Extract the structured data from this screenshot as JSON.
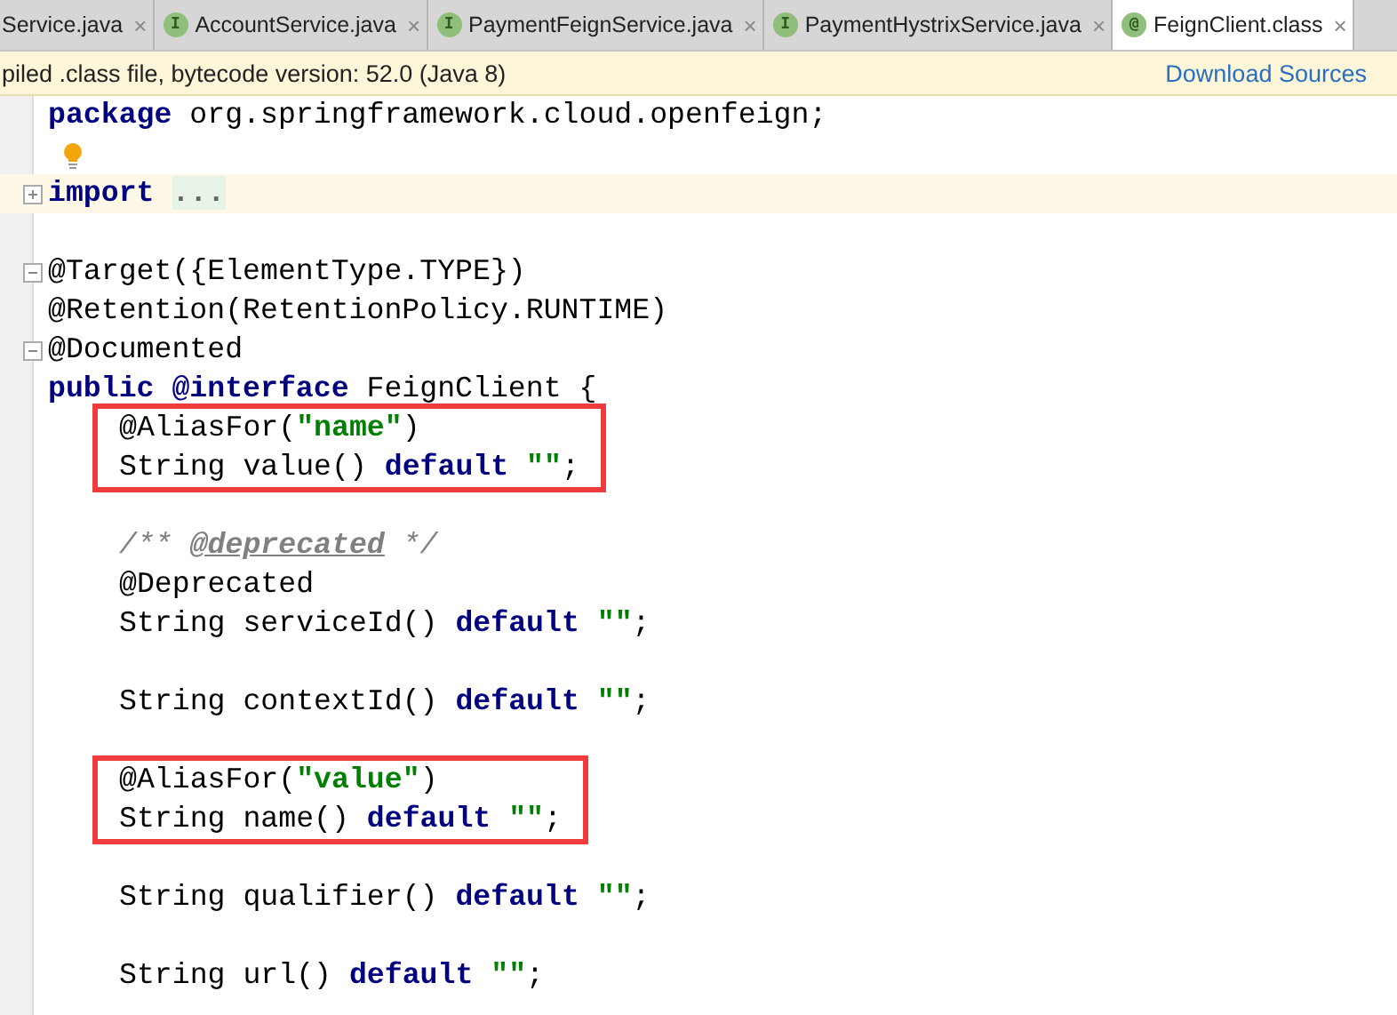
{
  "tabs": [
    {
      "label": "Service.java",
      "selected": false
    },
    {
      "label": "AccountService.java",
      "icon": "I",
      "selected": false
    },
    {
      "label": "PaymentFeignService.java",
      "icon": "I",
      "selected": false
    },
    {
      "label": "PaymentHystrixService.java",
      "icon": "I",
      "selected": false
    },
    {
      "label": "FeignClient.class",
      "icon": "@",
      "selected": true
    }
  ],
  "tab_close": "×",
  "banner": {
    "message": "piled .class file, bytecode version: 52.0 (Java 8)",
    "link": "Download Sources"
  },
  "code": [
    {
      "kind": "line",
      "tokens": [
        {
          "kind": "keyword",
          "text": "package"
        },
        {
          "kind": "plain",
          "text": " org.springframework.cloud.openfeign;"
        }
      ]
    },
    {
      "kind": "bulb"
    },
    {
      "kind": "line",
      "folded": true,
      "current": true,
      "tokens": [
        {
          "kind": "keyword",
          "text": "import "
        },
        {
          "kind": "folded",
          "text": "..."
        }
      ]
    },
    {
      "kind": "blank"
    },
    {
      "kind": "line",
      "folded": false,
      "tokens": [
        {
          "kind": "plain",
          "text": "@Target({ElementType.TYPE})"
        }
      ]
    },
    {
      "kind": "line",
      "tokens": [
        {
          "kind": "plain",
          "text": "@Retention(RetentionPolicy.RUNTIME)"
        }
      ]
    },
    {
      "kind": "line",
      "folded": false,
      "tokens": [
        {
          "kind": "plain",
          "text": "@Documented"
        }
      ]
    },
    {
      "kind": "line",
      "tokens": [
        {
          "kind": "keyword",
          "text": "public @interface"
        },
        {
          "kind": "plain",
          "text": " FeignClient {"
        }
      ],
      "children": [
        {
          "kind": "boxed",
          "lines": [
            {
              "kind": "line",
              "tokens": [
                {
                  "kind": "plain",
                  "text": "@AliasFor("
                },
                {
                  "kind": "string",
                  "text": "\"name\""
                },
                {
                  "kind": "plain",
                  "text": ")"
                }
              ]
            },
            {
              "kind": "line",
              "tokens": [
                {
                  "kind": "plain",
                  "text": "String value() "
                },
                {
                  "kind": "keyword",
                  "text": "default "
                },
                {
                  "kind": "string",
                  "text": "\"\""
                },
                {
                  "kind": "plain",
                  "text": ";"
                }
              ]
            }
          ]
        },
        {
          "kind": "blank"
        },
        {
          "kind": "line",
          "tokens": [
            {
              "kind": "comment",
              "text": "/** "
            },
            {
              "kind": "doctag",
              "text": "@deprecated"
            },
            {
              "kind": "comment",
              "text": " */"
            }
          ]
        },
        {
          "kind": "line",
          "tokens": [
            {
              "kind": "plain",
              "text": "@Deprecated"
            }
          ]
        },
        {
          "kind": "line",
          "tokens": [
            {
              "kind": "plain",
              "text": "String serviceId() "
            },
            {
              "kind": "keyword",
              "text": "default "
            },
            {
              "kind": "string",
              "text": "\"\""
            },
            {
              "kind": "plain",
              "text": ";"
            }
          ]
        },
        {
          "kind": "blank"
        },
        {
          "kind": "line",
          "tokens": [
            {
              "kind": "plain",
              "text": "String contextId() "
            },
            {
              "kind": "keyword",
              "text": "default "
            },
            {
              "kind": "string",
              "text": "\"\""
            },
            {
              "kind": "plain",
              "text": ";"
            }
          ]
        },
        {
          "kind": "blank"
        },
        {
          "kind": "boxed",
          "lines": [
            {
              "kind": "line",
              "tokens": [
                {
                  "kind": "plain",
                  "text": "@AliasFor("
                },
                {
                  "kind": "string",
                  "text": "\"value\""
                },
                {
                  "kind": "plain",
                  "text": ")"
                }
              ]
            },
            {
              "kind": "line",
              "tokens": [
                {
                  "kind": "plain",
                  "text": "String name() "
                },
                {
                  "kind": "keyword",
                  "text": "default "
                },
                {
                  "kind": "string",
                  "text": "\"\""
                },
                {
                  "kind": "plain",
                  "text": ";"
                }
              ]
            }
          ]
        },
        {
          "kind": "blank"
        },
        {
          "kind": "line",
          "tokens": [
            {
              "kind": "plain",
              "text": "String qualifier() "
            },
            {
              "kind": "keyword",
              "text": "default "
            },
            {
              "kind": "string",
              "text": "\"\""
            },
            {
              "kind": "plain",
              "text": ";"
            }
          ]
        },
        {
          "kind": "blank"
        },
        {
          "kind": "line",
          "tokens": [
            {
              "kind": "plain",
              "text": "String url() "
            },
            {
              "kind": "keyword",
              "text": "default "
            },
            {
              "kind": "string",
              "text": "\"\""
            },
            {
              "kind": "plain",
              "text": ";"
            }
          ]
        }
      ]
    }
  ]
}
